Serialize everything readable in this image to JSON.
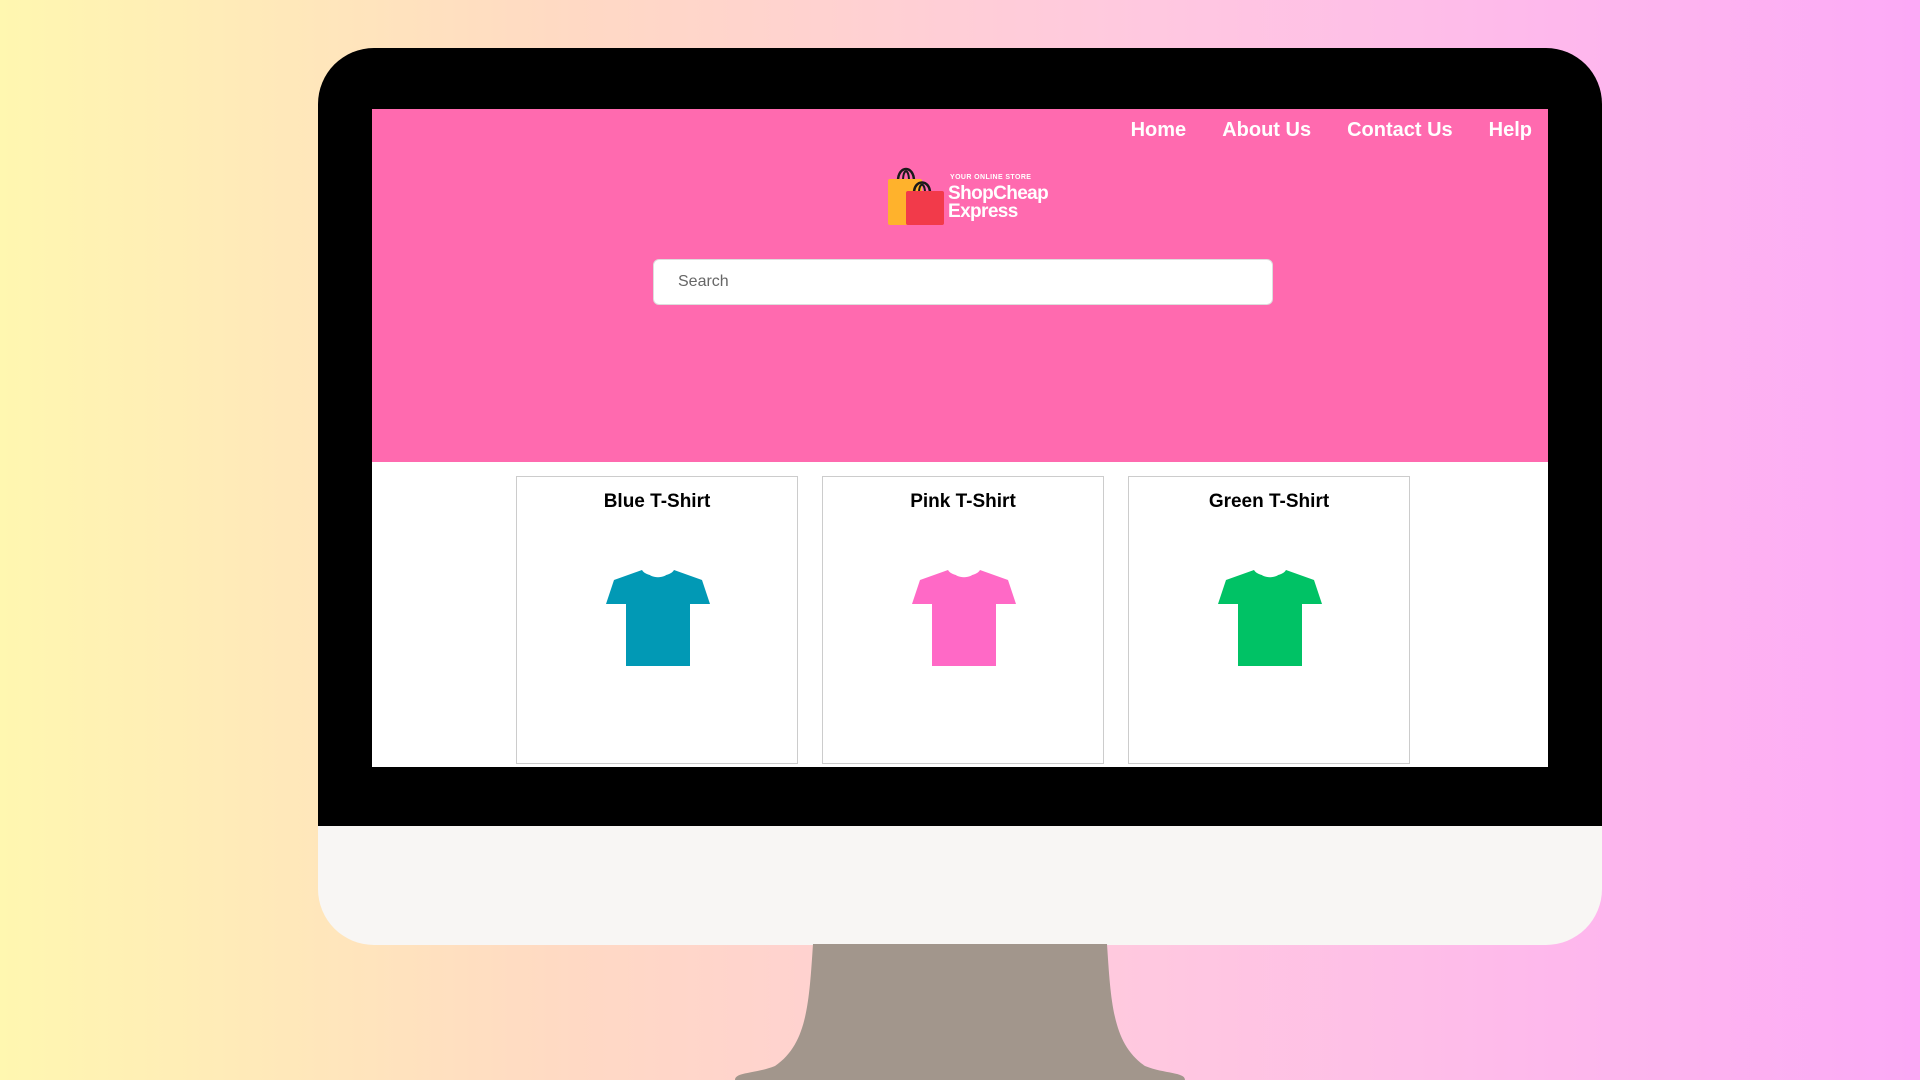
{
  "nav": {
    "items": [
      "Home",
      "About Us",
      "Contact Us",
      "Help"
    ]
  },
  "logo": {
    "tagline": "YOUR ONLINE STORE",
    "brand_line1": "ShopCheap",
    "brand_line2": "Express"
  },
  "search": {
    "placeholder": "Search",
    "value": ""
  },
  "products": [
    {
      "name": "Blue T-Shirt",
      "color": "#0199b5",
      "icon": "t-shirt-icon"
    },
    {
      "name": "Pink T-Shirt",
      "color": "#ff69c6",
      "icon": "t-shirt-icon"
    },
    {
      "name": "Green T-Shirt",
      "color": "#00c265",
      "icon": "t-shirt-icon"
    }
  ],
  "colors": {
    "hero_background": "#ff6aaf",
    "nav_text": "#ffffff",
    "bezel": "#000000",
    "chin": "#f8f6f4",
    "stand": "#a2968c"
  }
}
